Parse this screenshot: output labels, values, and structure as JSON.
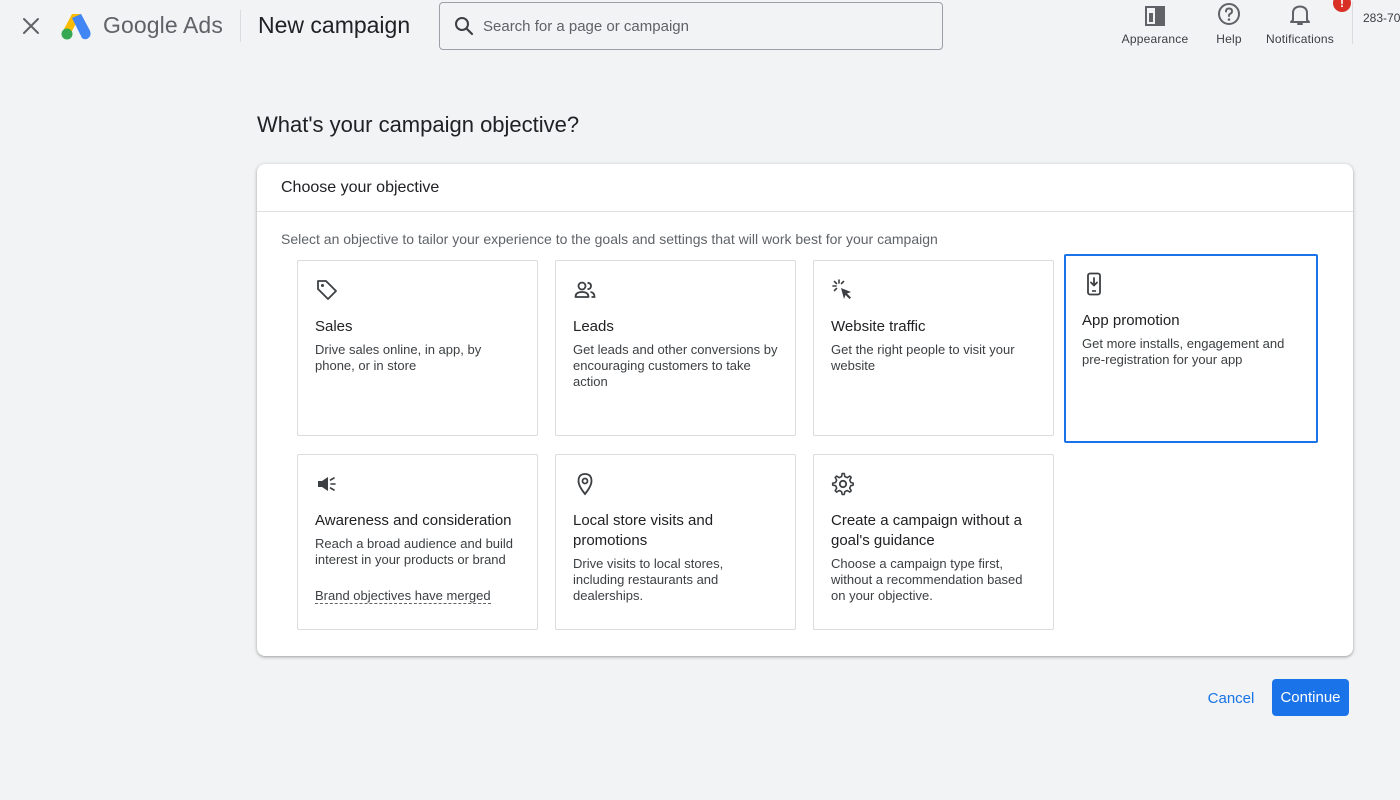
{
  "header": {
    "logo_text": "Google Ads",
    "page_heading": "New campaign",
    "search": {
      "placeholder": "Search for a page or campaign",
      "value": ""
    },
    "tools": {
      "appearance_label": "Appearance",
      "help_label": "Help",
      "notifications_label": "Notifications",
      "notification_badge": "!"
    },
    "account_id": "283-70"
  },
  "main": {
    "title": "What's your campaign objective?",
    "card": {
      "header": "Choose your objective",
      "description": "Select an objective to tailor your experience to the goals and settings that will work best for your campaign",
      "objectives": [
        {
          "icon": "tag-icon",
          "title": "Sales",
          "description": "Drive sales online, in app, by phone, or in store",
          "selected": false
        },
        {
          "icon": "people-icon",
          "title": "Leads",
          "description": "Get leads and other conversions by encouraging customers to take action",
          "selected": false
        },
        {
          "icon": "cursor-click-icon",
          "title": "Website traffic",
          "description": "Get the right people to visit your website",
          "selected": false
        },
        {
          "icon": "phone-download-icon",
          "title": "App promotion",
          "description": "Get more installs, engagement and pre-registration for your app",
          "selected": true
        },
        {
          "icon": "megaphone-icon",
          "title": "Awareness and consideration",
          "description": "Reach a broad audience and build interest in your products or brand",
          "link": "Brand objectives have merged",
          "selected": false
        },
        {
          "icon": "location-pin-icon",
          "title": "Local store visits and promotions",
          "description": "Drive visits to local stores, including restaurants and dealerships.",
          "selected": false
        },
        {
          "icon": "gear-icon",
          "title": "Create a campaign without a goal's guidance",
          "description": "Choose a campaign type first, without a recommendation based on your objective.",
          "selected": false
        }
      ]
    }
  },
  "footer": {
    "cancel_label": "Cancel",
    "continue_label": "Continue"
  },
  "colors": {
    "accent": "#1a73e8",
    "badge": "#d93025",
    "background": "#f1f3f4"
  }
}
